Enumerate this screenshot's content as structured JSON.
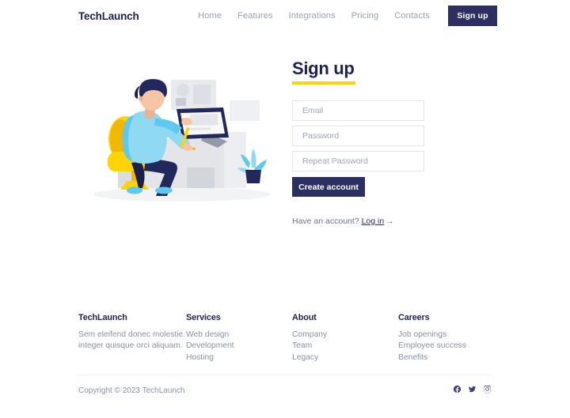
{
  "header": {
    "logo": "TechLaunch",
    "nav": [
      {
        "label": "Home"
      },
      {
        "label": "Features"
      },
      {
        "label": "Integrations"
      },
      {
        "label": "Pricing"
      },
      {
        "label": "Contacts"
      }
    ],
    "signup_button": "Sign up"
  },
  "illustration": {
    "alt": "person-at-desk-working-on-tablet-illustration",
    "colors": {
      "skin": "#f5c6a5",
      "hair": "#23285c",
      "shirt": "#8fd9f2",
      "shirt_shade": "#5ec8ee",
      "pants": "#23285c",
      "chair": "#ffd400",
      "chair_shade": "#f2b705",
      "desk": "#e3e5e9",
      "desk_panel": "#c9ccd2",
      "screen_bezel": "#23285c",
      "plant_leaf": "#5ec8ee",
      "plant_pot": "#23285c",
      "shoes": "#5ec8ee",
      "wall_art": "#e8eaee"
    }
  },
  "form": {
    "title": "Sign up",
    "accent_color": "#ffd400",
    "fields": [
      {
        "name": "email",
        "value": "",
        "placeholder": "Email"
      },
      {
        "name": "password",
        "value": "",
        "placeholder": "Password"
      },
      {
        "name": "repeat_password",
        "value": "",
        "placeholder": "Repeat Password"
      }
    ],
    "submit_label": "Create account",
    "have_account_text": "Have an account?",
    "login_label": "Log in",
    "login_arrow": "→"
  },
  "footer": {
    "brand": {
      "title": "TechLaunch",
      "description_line1": "Sem eleifend donec molestie.",
      "description_line2": "integer quisque orci aliquam."
    },
    "columns": [
      {
        "title": "Services",
        "links": [
          {
            "label": "Web design"
          },
          {
            "label": "Development"
          },
          {
            "label": "Hosting"
          }
        ]
      },
      {
        "title": "About",
        "links": [
          {
            "label": "Company"
          },
          {
            "label": "Team"
          },
          {
            "label": "Legacy"
          }
        ]
      },
      {
        "title": "Careers",
        "links": [
          {
            "label": "Job openings"
          },
          {
            "label": "Employee success"
          },
          {
            "label": "Benefits"
          }
        ]
      }
    ],
    "copyright": "Copyright © 2023 TechLaunch",
    "socials": [
      {
        "name": "facebook-icon"
      },
      {
        "name": "twitter-icon"
      },
      {
        "name": "instagram-icon"
      }
    ]
  },
  "theme": {
    "navy": "#2b2f62",
    "yellow": "#ffd400",
    "muted": "#9fa3b8",
    "background": "#ffffff"
  }
}
